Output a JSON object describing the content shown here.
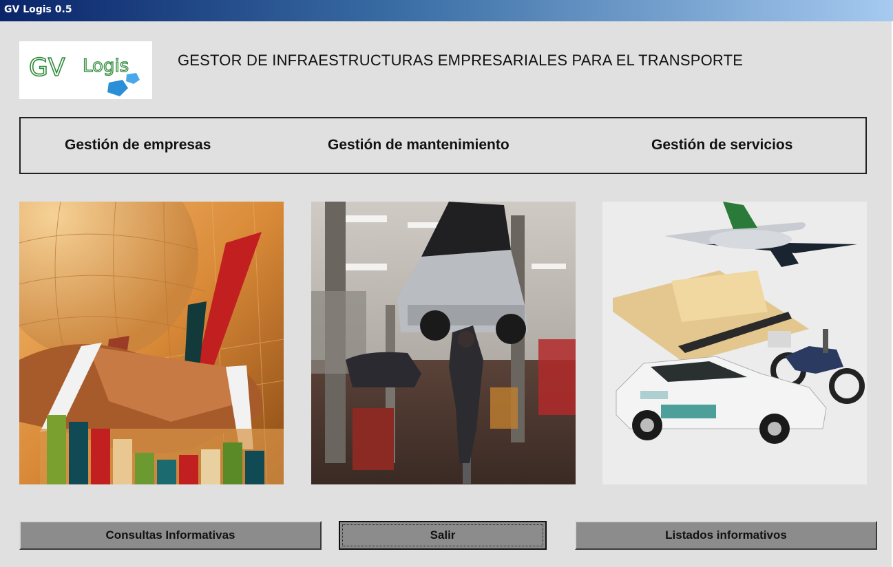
{
  "window": {
    "title": "GV Logis 0.5"
  },
  "logo": {
    "text_gv": "GV",
    "text_logis": "Logis"
  },
  "header": {
    "heading": "GESTOR DE INFRAESTRUCTURAS EMPRESARIALES PARA EL TRANSPORTE"
  },
  "nav": {
    "items": [
      {
        "label": "Gestión de empresas"
      },
      {
        "label": "Gestión de mantenimiento"
      },
      {
        "label": "Gestión de servicios"
      }
    ]
  },
  "images": {
    "empresas": "handshake-business-chart-image",
    "mantenimiento": "car-workshop-lift-image",
    "servicios": "transport-vehicles-image"
  },
  "buttons": {
    "consultas_label": "Consultas Informativas",
    "salir_label": "Salir",
    "listados_label": "Listados informativos"
  },
  "colors": {
    "titlebar_start": "#0a246a",
    "titlebar_end": "#a6caf0",
    "window_bg": "#e0e0e0",
    "button_face": "#8c8c8c",
    "logo_green": "#2e8b3a",
    "logo_blue": "#2a8fd6"
  }
}
